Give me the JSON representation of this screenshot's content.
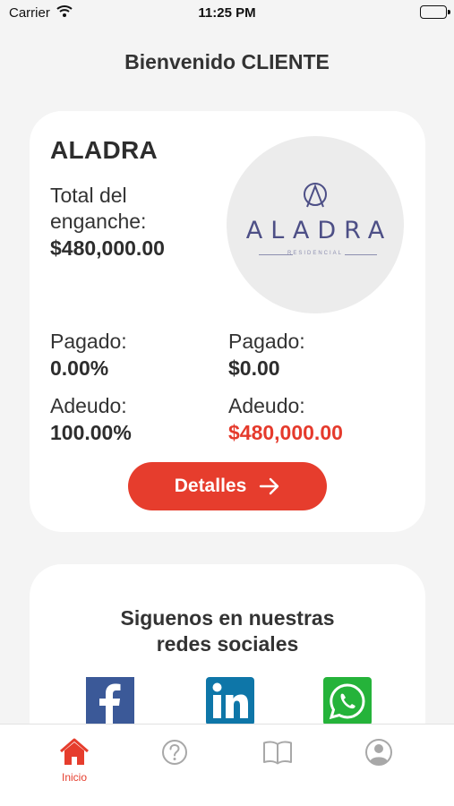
{
  "status_bar": {
    "carrier": "Carrier",
    "time": "11:25 PM"
  },
  "header": {
    "welcome": "Bienvenido CLIENTE"
  },
  "project": {
    "name": "ALADRA",
    "down_payment_label": "Total del enganche:",
    "down_payment_value": "$480,000.00",
    "logo": {
      "word": "ALADRA",
      "subtitle": "RESIDENCIAL"
    },
    "paid_pct_label": "Pagado:",
    "paid_pct_value": "0.00%",
    "paid_amount_label": "Pagado:",
    "paid_amount_value": "$0.00",
    "owed_pct_label": "Adeudo:",
    "owed_pct_value": "100.00%",
    "owed_amount_label": "Adeudo:",
    "owed_amount_value": "$480,000.00",
    "details_button": "Detalles"
  },
  "social": {
    "title_line1": "Siguenos en nuestras",
    "title_line2": "redes sociales",
    "icons": [
      "facebook-icon",
      "linkedin-icon",
      "whatsapp-icon"
    ]
  },
  "tab_bar": {
    "tabs": [
      {
        "icon": "home-icon",
        "label": "Inicio",
        "active": true
      },
      {
        "icon": "help-icon",
        "label": "",
        "active": false
      },
      {
        "icon": "book-icon",
        "label": "",
        "active": false
      },
      {
        "icon": "profile-icon",
        "label": "",
        "active": false
      }
    ]
  },
  "colors": {
    "accent": "#e63d2d",
    "owed_text": "#e53a2c",
    "background": "#f4f4f4",
    "card": "#ffffff",
    "logo_text": "#4d4f86",
    "facebook": "#3b5998",
    "linkedin": "#0e76a8",
    "whatsapp": "#25b33a",
    "tab_inactive": "#a8a8a8"
  }
}
